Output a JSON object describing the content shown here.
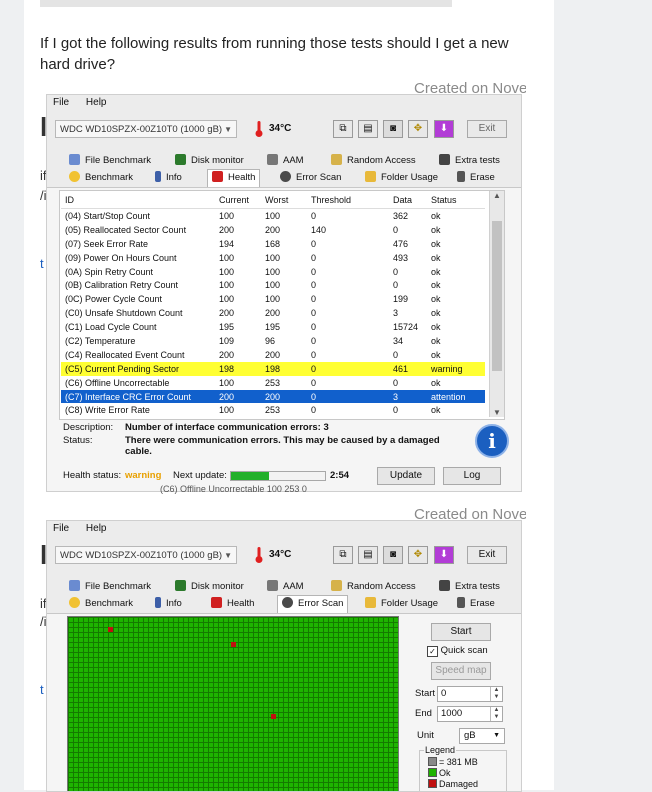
{
  "question": "If I got the following results from running those tests should I get a new hard drive?",
  "created_label": "Created on Nove",
  "behind_text": "(C6) Offline Uncorrectable   100   253   0",
  "screenshots": [
    {
      "menu": [
        "File",
        "Help"
      ],
      "drive": "WDC WD10SPZX-00Z10T0 (1000 gB)",
      "temperature": "34°C",
      "exit_label": "Exit",
      "tabs_row1": [
        "File Benchmark",
        "Disk monitor",
        "AAM",
        "Random Access",
        "Extra tests"
      ],
      "tabs_row2": [
        "Benchmark",
        "Info",
        "Health",
        "Error Scan",
        "Folder Usage",
        "Erase"
      ],
      "active_tab": "Health",
      "columns": [
        "ID",
        "Current",
        "Worst",
        "Threshold",
        "Data",
        "Status"
      ],
      "rows": [
        [
          "(04) Start/Stop Count",
          "100",
          "100",
          "0",
          "362",
          "ok"
        ],
        [
          "(05) Reallocated Sector Count",
          "200",
          "200",
          "140",
          "0",
          "ok"
        ],
        [
          "(07) Seek Error Rate",
          "194",
          "168",
          "0",
          "476",
          "ok"
        ],
        [
          "(09) Power On Hours Count",
          "100",
          "100",
          "0",
          "493",
          "ok"
        ],
        [
          "(0A) Spin Retry Count",
          "100",
          "100",
          "0",
          "0",
          "ok"
        ],
        [
          "(0B) Calibration Retry Count",
          "100",
          "100",
          "0",
          "0",
          "ok"
        ],
        [
          "(0C) Power Cycle Count",
          "100",
          "100",
          "0",
          "199",
          "ok"
        ],
        [
          "(C0) Unsafe Shutdown Count",
          "200",
          "200",
          "0",
          "3",
          "ok"
        ],
        [
          "(C1) Load Cycle Count",
          "195",
          "195",
          "0",
          "15724",
          "ok"
        ],
        [
          "(C2) Temperature",
          "109",
          "96",
          "0",
          "34",
          "ok"
        ],
        [
          "(C4) Reallocated Event Count",
          "200",
          "200",
          "0",
          "0",
          "ok"
        ],
        [
          "(C5) Current Pending Sector",
          "198",
          "198",
          "0",
          "461",
          "warning"
        ],
        [
          "(C6) Offline Uncorrectable",
          "100",
          "253",
          "0",
          "0",
          "ok"
        ],
        [
          "(C7) Interface CRC Error Count",
          "200",
          "200",
          "0",
          "3",
          "attention"
        ],
        [
          "(C8) Write Error Rate",
          "100",
          "253",
          "0",
          "0",
          "ok"
        ]
      ],
      "description_label": "Description:",
      "description": "Number of interface communication errors: 3",
      "status_label": "Status:",
      "status_line1": "There were communication errors. This may be caused by a damaged",
      "status_line2": "cable.",
      "health_status_label": "Health status:",
      "health_status": "warning",
      "next_update_label": "Next update:",
      "next_update_progress": 0.4,
      "next_update_time": "2:54",
      "update_label": "Update",
      "log_label": "Log"
    },
    {
      "menu": [
        "File",
        "Help"
      ],
      "drive": "WDC WD10SPZX-00Z10T0 (1000 gB)",
      "temperature": "34°C",
      "exit_label": "Exit",
      "tabs_row1": [
        "File Benchmark",
        "Disk monitor",
        "AAM",
        "Random Access",
        "Extra tests"
      ],
      "tabs_row2": [
        "Benchmark",
        "Info",
        "Health",
        "Error Scan",
        "Folder Usage",
        "Erase"
      ],
      "active_tab": "Error Scan",
      "start_label": "Start",
      "quick_scan_label": "Quick scan",
      "quick_scan_checked": true,
      "speed_map_label": "Speed map",
      "start_field_label": "Start",
      "start_value": "0",
      "end_field_label": "End",
      "end_value": "1000",
      "unit_label": "Unit",
      "unit_value": "gB",
      "legend_title": "Legend",
      "legend_items": [
        "= 381 MB",
        "Ok",
        "Damaged"
      ]
    }
  ]
}
